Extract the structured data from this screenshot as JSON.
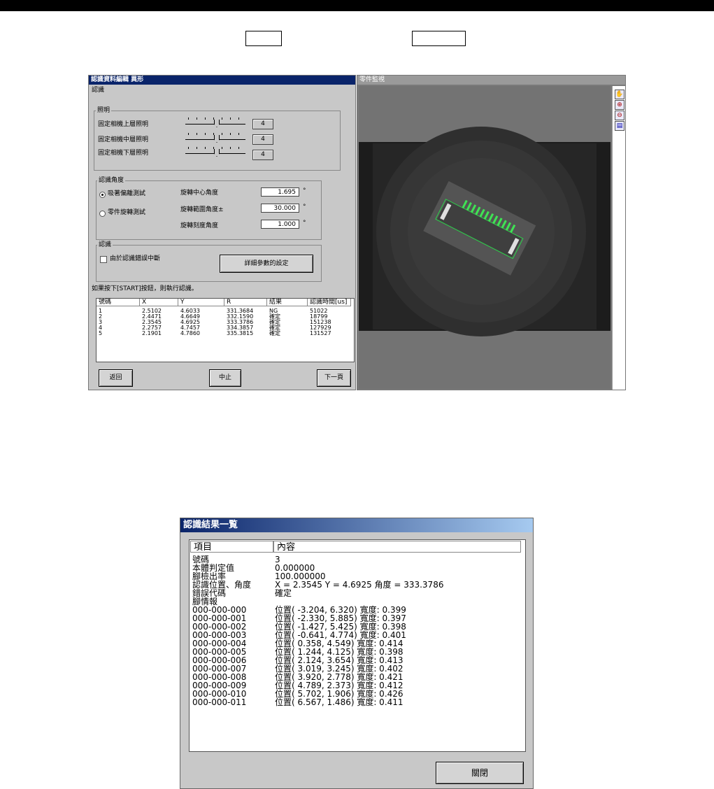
{
  "shot1": {
    "left_window": {
      "title": "認識資料編輯 異形",
      "section_label": "認識",
      "lighting": {
        "group_label": "照明",
        "rows": [
          {
            "label": "固定相機上層照明",
            "value": "4"
          },
          {
            "label": "固定相機中層照明",
            "value": "4"
          },
          {
            "label": "固定相機下層照明",
            "value": "4"
          }
        ]
      },
      "angle": {
        "group_label": "認識角度",
        "radio_options": [
          "吸著偏離測試",
          "零件旋轉測試"
        ],
        "fields": [
          {
            "label": "旋轉中心角度",
            "value": "1.695",
            "unit": "°"
          },
          {
            "label": "旋轉範圍角度±",
            "value": "30.000",
            "unit": "°"
          },
          {
            "label": "旋轉刻度角度",
            "value": "1.000",
            "unit": "°"
          }
        ]
      },
      "recog": {
        "group_label": "認識",
        "checkbox_label": "由於認識錯誤中斷",
        "detail_button": "詳細參數的設定"
      },
      "hint": "如果按下[START]按鈕，則執行認識。",
      "list": {
        "headers": [
          "號碼",
          "X",
          "Y",
          "R",
          "結果",
          "認識時間[us]"
        ],
        "rows": [
          [
            "1",
            "2.5102",
            "4.6033",
            "331.3684",
            "NG",
            "51022"
          ],
          [
            "2",
            "2.4471",
            "4.6649",
            "332.1590",
            "確定",
            "18799"
          ],
          [
            "3",
            "2.3545",
            "4.6925",
            "333.3786",
            "確定",
            "151238"
          ],
          [
            "4",
            "2.2757",
            "4.7457",
            "334.3857",
            "確定",
            "127929"
          ],
          [
            "5",
            "2.1901",
            "4.7860",
            "335.3815",
            "確定",
            "131527"
          ]
        ]
      },
      "buttons": {
        "back": "返回",
        "stop": "中止",
        "next": "下一頁"
      }
    },
    "right_window": {
      "title": "零件監視"
    }
  },
  "dialog": {
    "title": "認識結果一覧",
    "headers": [
      "項目",
      "內容"
    ],
    "rows": [
      {
        "k": "號碼",
        "v": "3"
      },
      {
        "k": "本體判定值",
        "v": "0.000000"
      },
      {
        "k": "腳檢出率",
        "v": "100.000000"
      },
      {
        "k": "認識位置、角度",
        "v": "X =   2.3545 Y =   4.6925 角度 = 333.3786"
      },
      {
        "k": "錯誤代碼",
        "v": "確定"
      },
      {
        "k": "腳情報",
        "v": ""
      },
      {
        "k": "000-000-000",
        "v": "位置( -3.204,    6.320) 寬度:  0.399"
      },
      {
        "k": "000-000-001",
        "v": "位置( -2.330,    5.885) 寬度:  0.397"
      },
      {
        "k": "000-000-002",
        "v": "位置( -1.427,    5.425) 寬度:  0.398"
      },
      {
        "k": "000-000-003",
        "v": "位置( -0.641,    4.774) 寬度:  0.401"
      },
      {
        "k": "000-000-004",
        "v": "位置(  0.358,    4.549) 寬度:  0.414"
      },
      {
        "k": "000-000-005",
        "v": "位置(  1.244,    4.125) 寬度:  0.398"
      },
      {
        "k": "000-000-006",
        "v": "位置(  2.124,    3.654) 寬度:  0.413"
      },
      {
        "k": "000-000-007",
        "v": "位置(  3.019,    3.245) 寬度:  0.402"
      },
      {
        "k": "000-000-008",
        "v": "位置(  3.920,    2.778) 寬度:  0.421"
      },
      {
        "k": "000-000-009",
        "v": "位置(  4.789,    2.373) 寬度:  0.412"
      },
      {
        "k": "000-000-010",
        "v": "位置(  5.702,    1.906) 寬度:  0.426"
      },
      {
        "k": "000-000-011",
        "v": "位置(  6.567,    1.486) 寬度:  0.411"
      }
    ],
    "close_button": "關閉"
  }
}
